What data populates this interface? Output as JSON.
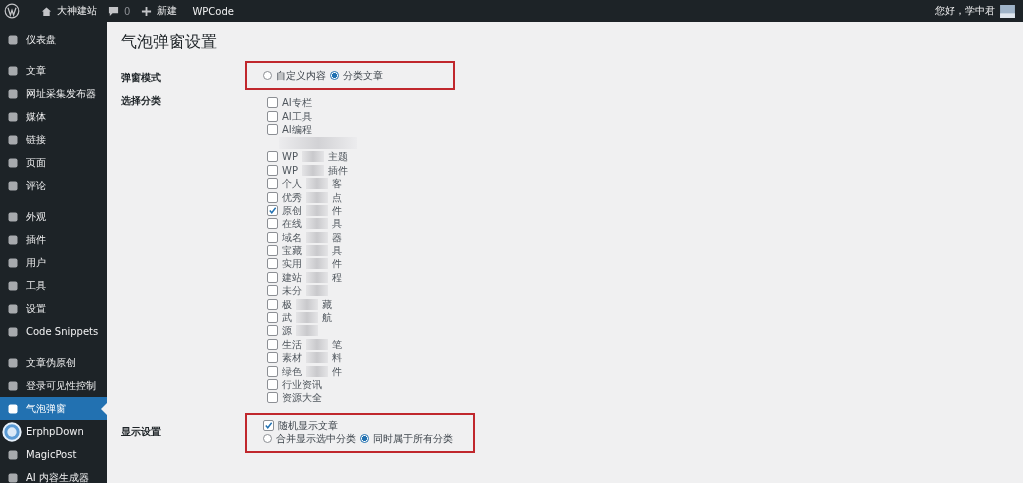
{
  "admin_bar": {
    "site_name": "大神建站",
    "comments_count": "0",
    "new_label": "新建",
    "plugin_link": "WPCode",
    "greeting": "您好，学中君"
  },
  "sidebar": {
    "groups": [
      [
        {
          "label": "仪表盘",
          "selected": false
        }
      ],
      [
        {
          "label": "文章",
          "selected": false
        },
        {
          "label": "网址采集发布器",
          "selected": false
        },
        {
          "label": "媒体",
          "selected": false
        },
        {
          "label": "链接",
          "selected": false
        },
        {
          "label": "页面",
          "selected": false
        },
        {
          "label": "评论",
          "selected": false
        }
      ],
      [
        {
          "label": "外观",
          "selected": false
        },
        {
          "label": "插件",
          "selected": false
        },
        {
          "label": "用户",
          "selected": false
        },
        {
          "label": "工具",
          "selected": false
        },
        {
          "label": "设置",
          "selected": false
        },
        {
          "label": "Code Snippets",
          "selected": false
        }
      ],
      [
        {
          "label": "文章伪原创",
          "selected": false
        },
        {
          "label": "登录可见性控制",
          "selected": false
        },
        {
          "label": "气泡弹窗",
          "selected": true
        },
        {
          "label": "ErphpDown",
          "selected": false
        },
        {
          "label": "MagicPost",
          "selected": false
        },
        {
          "label": "AI 内容生成器",
          "selected": false
        }
      ]
    ]
  },
  "page": {
    "title": "气泡弹窗设置",
    "sections": [
      {
        "kind": "radio",
        "label": "弹窗模式",
        "highlighted": true,
        "options": [
          {
            "label": "自定义内容",
            "selected": false
          },
          {
            "label": "分类文章",
            "selected": true
          }
        ]
      },
      {
        "kind": "checklist",
        "label": "选择分类",
        "highlighted": false,
        "items": [
          {
            "kind": "option",
            "start": "AI专栏",
            "checked": false
          },
          {
            "kind": "option",
            "start": "AI工具",
            "checked": false
          },
          {
            "kind": "option",
            "start": "AI编程",
            "checked": false
          },
          {
            "kind": "redacted"
          },
          {
            "kind": "blurred",
            "start": "WP",
            "end": "主题",
            "checked": false
          },
          {
            "kind": "blurred",
            "start": "WP",
            "end": "插件",
            "checked": false
          },
          {
            "kind": "blurred",
            "start": "个人",
            "end": "客",
            "checked": false
          },
          {
            "kind": "blurred",
            "start": "优秀",
            "end": "点",
            "checked": false
          },
          {
            "kind": "blurred",
            "start": "原创",
            "end": "件",
            "checked": true
          },
          {
            "kind": "blurred",
            "start": "在线",
            "end": "具",
            "checked": false
          },
          {
            "kind": "blurred",
            "start": "域名",
            "end": "器",
            "checked": false
          },
          {
            "kind": "blurred",
            "start": "宝藏",
            "end": "具",
            "checked": false
          },
          {
            "kind": "blurred",
            "start": "实用",
            "end": "件",
            "checked": false
          },
          {
            "kind": "blurred",
            "start": "建站",
            "end": "程",
            "checked": false
          },
          {
            "kind": "blurred",
            "start": "未分",
            "checked": false
          },
          {
            "kind": "blurred",
            "start": "极",
            "end": "藏",
            "checked": false
          },
          {
            "kind": "blurred",
            "start": "武",
            "end": "航",
            "checked": false
          },
          {
            "kind": "blurred",
            "start": "源",
            "checked": false
          },
          {
            "kind": "blurred",
            "start": "生活",
            "end": "笔",
            "checked": false
          },
          {
            "kind": "blurred",
            "start": "素材",
            "end": "料",
            "checked": false
          },
          {
            "kind": "blurred",
            "start": "绿色",
            "end": "件",
            "checked": false
          },
          {
            "kind": "option",
            "start": "行业资讯",
            "checked": false
          },
          {
            "kind": "option",
            "start": "资源大全",
            "checked": false
          }
        ]
      },
      {
        "kind": "display",
        "label": "显示设置",
        "highlighted": true,
        "checkbox": {
          "label": "随机显示文章",
          "checked": true
        },
        "options": [
          {
            "label": "合并显示选中分类",
            "selected": false
          },
          {
            "label": "同时属于所有分类",
            "selected": true
          }
        ]
      }
    ]
  }
}
